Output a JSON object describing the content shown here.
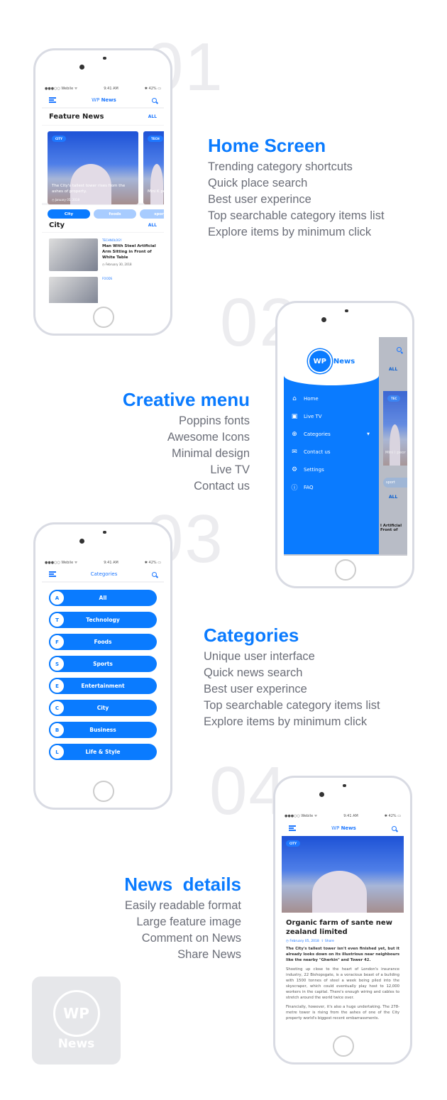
{
  "colors": {
    "accent": "#0a7bff",
    "text": "#6b6e78",
    "number": "#ececef"
  },
  "status": {
    "carrier": "●●●○○ Webile ᯤ",
    "time": "9:41 AM",
    "battery": "✱ 42% ▭"
  },
  "app": {
    "title_prefix": "WP",
    "title_bold": "News",
    "categories_title": "Categories"
  },
  "sections": [
    {
      "number": "01",
      "title": "Home Screen",
      "lines": [
        "Trending category shortcuts",
        "Quick place search",
        "Best user experince",
        "Top searchable category items list",
        "Explore items by minimum click"
      ]
    },
    {
      "number": "02",
      "title": "Creative menu",
      "lines": [
        "Poppins fonts",
        "Awesome Icons",
        "Minimal design",
        "Live TV",
        "Contact us"
      ]
    },
    {
      "number": "03",
      "title": "Categories",
      "lines": [
        "Unique user interface",
        "Quick news search",
        "Best user experince",
        "Top searchable category items list",
        "Explore items by minimum click"
      ]
    },
    {
      "number": "04",
      "title": "News  details",
      "lines": [
        "Easily readable format",
        "Large feature image",
        "Comment on News",
        "Share News"
      ]
    }
  ],
  "home": {
    "feature_title": "Feature News",
    "all": "ALL",
    "card": {
      "tag": "CITY",
      "caption": "The City's tallest tower rises from the ashes of property.",
      "date": "◷ January 05, 2018"
    },
    "card2": {
      "tag": "TECH",
      "caption": "Mini K peor",
      "date": "◷ Febr"
    },
    "chips": [
      "City",
      "foods",
      "sports"
    ],
    "city_title": "City",
    "items": [
      {
        "category": "TECHNOLOGY",
        "title": "Man With Steel Artificial Arm Sitting in Front of White Table",
        "date": "◷ February 30, 2018"
      },
      {
        "category": "FOODS",
        "title": "",
        "date": ""
      }
    ]
  },
  "menu": {
    "logo_wp": "WP",
    "logo_news": "News",
    "items": [
      {
        "icon": "home-icon",
        "label": "Home"
      },
      {
        "icon": "tv-icon",
        "label": "Live TV"
      },
      {
        "icon": "plus-circle-icon",
        "label": "Categories"
      },
      {
        "icon": "mail-icon",
        "label": "Contact us"
      },
      {
        "icon": "gear-icon",
        "label": "Settings"
      },
      {
        "icon": "question-icon",
        "label": "FAQ"
      }
    ],
    "behind": {
      "all": "ALL",
      "tag": "TEC",
      "caption": "Mini l peor",
      "chip": "sport",
      "snippet": "l Artificial Front of"
    }
  },
  "categories": [
    {
      "letter": "A",
      "label": "All"
    },
    {
      "letter": "T",
      "label": "Technology"
    },
    {
      "letter": "F",
      "label": "Foods"
    },
    {
      "letter": "S",
      "label": "Sports"
    },
    {
      "letter": "E",
      "label": "Entertainment"
    },
    {
      "letter": "C",
      "label": "City"
    },
    {
      "letter": "B",
      "label": "Business"
    },
    {
      "letter": "L",
      "label": "Life & Style"
    }
  ],
  "article": {
    "tag": "CITY",
    "title": "Organic farm of sante new zealand limited",
    "date": "◷ February 05, 2018",
    "share": "⇧ Share",
    "lead": "The City's tallest tower isn't even finished yet, but it already looks down on its illustrious near neighbours like the nearby \"Gherkin\" and Tower 42.",
    "p1": "Shooting up close to the heart of London's insurance industry, 22 Bishopsgate, is a voracious beast of a building with 1500 tonnes of steel a week being piled into the skyscraper, which could eventually play host to 12,000 workers in the capital. There's enough wiring and cables to stretch around the world twice over.",
    "p2": "Financially, however, it's also a huge undertaking. The 278-metre tower is rising from the ashes of one of the City property world's biggest recent embarrassments."
  },
  "tile": {
    "wp": "WP",
    "news": "News"
  }
}
